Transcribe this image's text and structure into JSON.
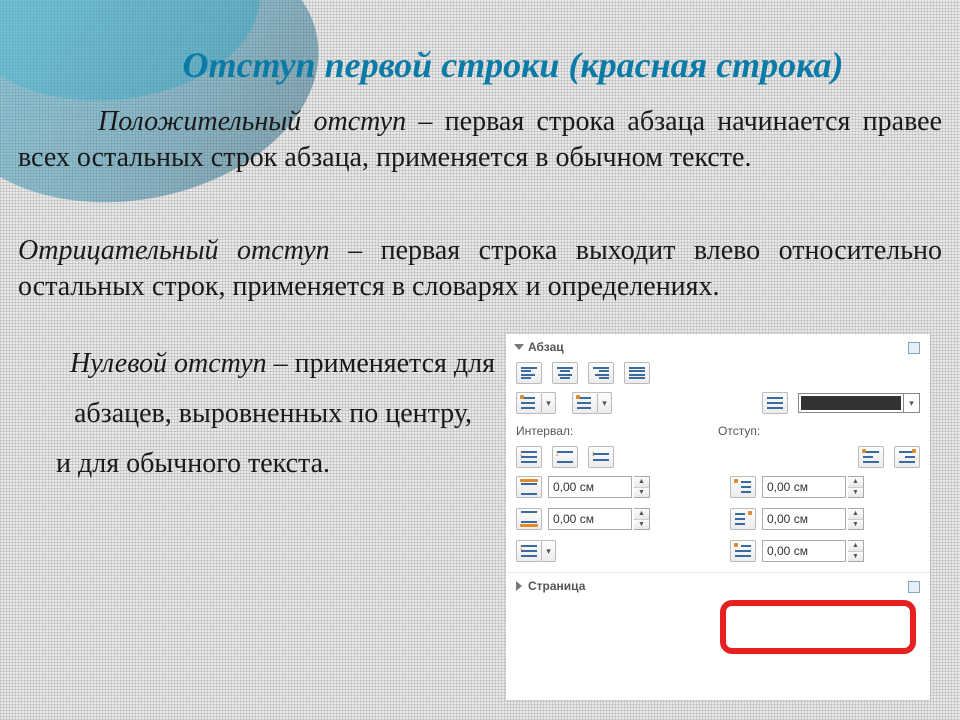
{
  "title": "Отступ первой строки (красная строка)",
  "para1_em": "Положительный отступ",
  "para1_rest": " – первая строка абзаца начинается правее всех остальных строк абзаца, применяется в обычном тексте.",
  "para2_em": "Отрицательный отступ",
  "para2_rest": " – первая строка выходит влево относительно остальных строк, применяется в словарях и определениях.",
  "para3_em": "Нулевой отступ",
  "para3_l1_rest": " – применяется для",
  "para3_l2": "абзацев, выровненных по центру,",
  "para3_l3": "и для обычного текста.",
  "panel": {
    "section1_title": "Абзац",
    "label_interval": "Интервал:",
    "label_indent": "Отступ:",
    "intervals": {
      "v1": "0,00 см",
      "v2": "0,00 см"
    },
    "indents": {
      "v1": "0,00 см",
      "v2": "0,00 см",
      "v3": "0,00 см"
    },
    "section2_title": "Страница"
  }
}
